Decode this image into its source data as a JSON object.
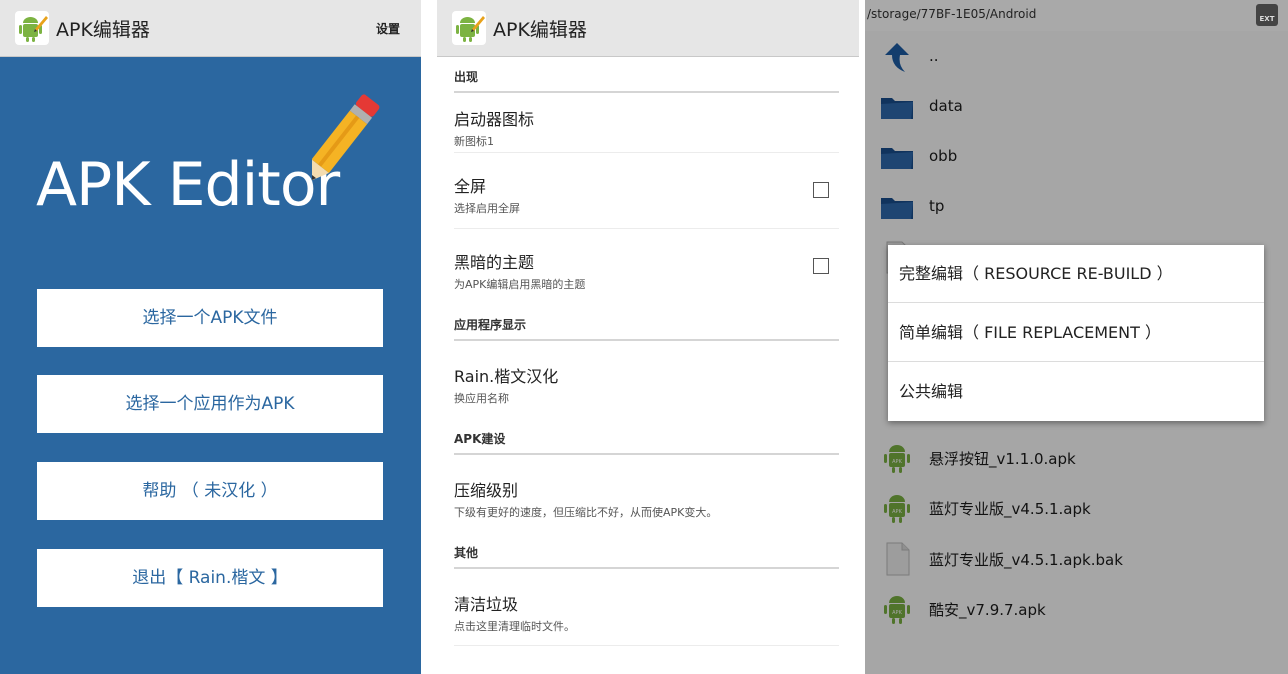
{
  "home": {
    "app_title": "APK编辑器",
    "settings_label": "设置",
    "brand_text": "APK Editor",
    "menu": [
      {
        "label": "选择一个APK文件"
      },
      {
        "label": "选择一个应用作为APK"
      },
      {
        "label": "帮助 （ 未汉化 ）"
      },
      {
        "label": "退出【 Rain.楷文 】"
      }
    ]
  },
  "settings": {
    "app_title": "APK编辑器",
    "sections": [
      {
        "header": "出现"
      },
      {
        "header": "应用程序显示"
      },
      {
        "header": "APK建设"
      },
      {
        "header": "其他"
      }
    ],
    "prefs": [
      {
        "title": "启动器图标",
        "summary": "新图标1"
      },
      {
        "title": "全屏",
        "summary": "选择启用全屏",
        "checked": false
      },
      {
        "title": "黑暗的主题",
        "summary": "为APK编辑启用黑暗的主题",
        "checked": false
      },
      {
        "title": "Rain.楷文汉化",
        "summary": "换应用名称"
      },
      {
        "title": "压缩级别",
        "summary": "下级有更好的速度，但压缩比不好，从而使APK变大。"
      },
      {
        "title": "清洁垃圾",
        "summary": "点击这里清理临时文件。"
      }
    ]
  },
  "browser": {
    "path": "/storage/77BF-1E05/Android",
    "ext_badge": "EXT",
    "files": [
      {
        "name": "..",
        "icon": "up-arrow-icon"
      },
      {
        "name": "data",
        "icon": "folder-icon"
      },
      {
        "name": "obb",
        "icon": "folder-icon"
      },
      {
        "name": "tp",
        "icon": "folder-icon"
      },
      {
        "name": "悬浮按钮_v1.1.0.apk",
        "icon": "android-apk-icon"
      },
      {
        "name": "蓝灯专业版_v4.5.1.apk",
        "icon": "android-apk-icon"
      },
      {
        "name": "蓝灯专业版_v4.5.1.apk.bak",
        "icon": "file-icon"
      },
      {
        "name": "酷安_v7.9.7.apk",
        "icon": "android-apk-icon"
      }
    ],
    "dialog": [
      {
        "label": "完整编辑（ RESOURCE RE-BUILD ）"
      },
      {
        "label": "简单编辑（ FILE REPLACEMENT ）"
      },
      {
        "label": "公共编辑"
      }
    ]
  },
  "colors": {
    "brand_blue": "#2b67a0",
    "android_green": "#7cb342",
    "folder_blue": "#2e6ab0"
  }
}
